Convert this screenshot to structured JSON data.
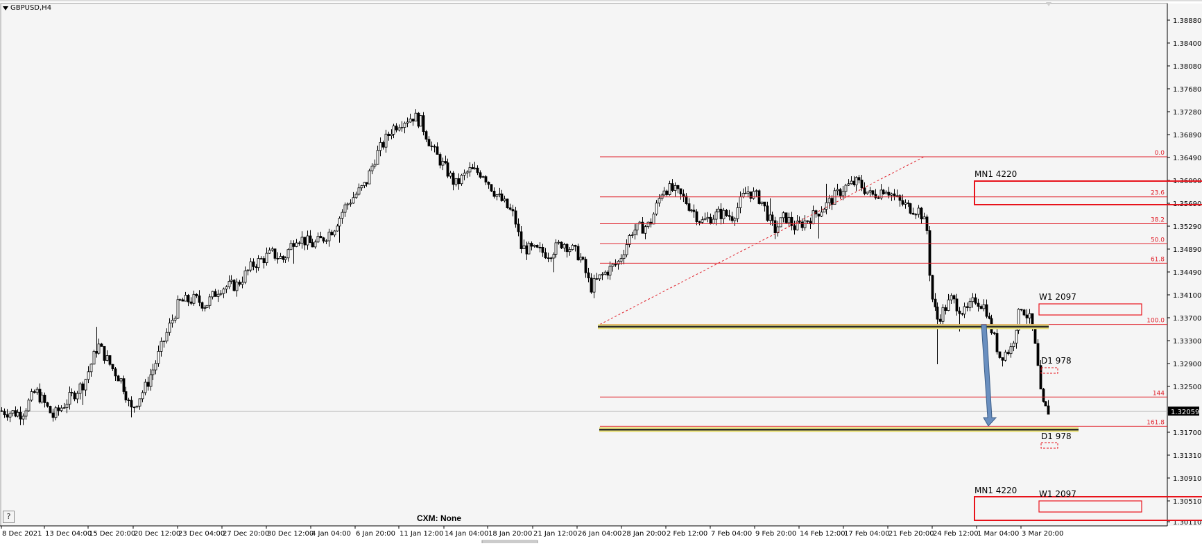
{
  "window": {
    "symbol": "GBPUSD,H4",
    "dropdown_icon": "triangle-down-icon",
    "help_label": "?"
  },
  "overlay": {
    "cxm_label": "CXM: None"
  },
  "price_axis": {
    "ticks": [
      "1.38880",
      "1.38400",
      "1.38080",
      "1.37680",
      "1.37280",
      "1.36890",
      "1.36490",
      "1.36090",
      "1.35690",
      "1.35290",
      "1.34890",
      "1.34490",
      "1.34100",
      "1.33700",
      "1.33300",
      "1.32900",
      "1.32500",
      "1.32059",
      "1.31700",
      "1.31310",
      "1.30910",
      "1.30510",
      "1.30110"
    ],
    "current_price": "1.32059"
  },
  "time_axis": {
    "labels": [
      "8 Dec 2021",
      "13 Dec 04:00",
      "15 Dec 20:00",
      "20 Dec 12:00",
      "23 Dec 04:00",
      "27 Dec 20:00",
      "30 Dec 12:00",
      "4 Jan 04:00",
      "6 Jan 20:00",
      "11 Jan 12:00",
      "14 Jan 04:00",
      "18 Jan 20:00",
      "21 Jan 12:00",
      "26 Jan 04:00",
      "28 Jan 20:00",
      "2 Feb 12:00",
      "7 Feb 04:00",
      "9 Feb 20:00",
      "14 Feb 12:00",
      "17 Feb 04:00",
      "21 Feb 20:00",
      "24 Feb 12:00",
      "1 Mar 04:00",
      "3 Mar 20:00"
    ]
  },
  "fibonacci": {
    "levels": [
      {
        "label": "0.0",
        "price": 1.3649
      },
      {
        "label": "23.6",
        "price": 1.3579
      },
      {
        "label": "38.2",
        "price": 1.3532
      },
      {
        "label": "50.0",
        "price": 1.3497
      },
      {
        "label": "61.8",
        "price": 1.3463
      },
      {
        "label": "100.0",
        "price": 1.3356
      },
      {
        "label": "144",
        "price": 1.3229
      },
      {
        "label": "161.8",
        "price": 1.3178
      }
    ]
  },
  "zones": [
    {
      "label": "MN1 4220",
      "style": "solid"
    },
    {
      "label": "W1 2097",
      "style": "solid"
    },
    {
      "label": "D1 978",
      "style": "dashed"
    },
    {
      "label": "D1 978",
      "style": "dashed"
    },
    {
      "label": "MN1 4220",
      "style": "solid"
    },
    {
      "label": "W1 2097",
      "style": "solid"
    }
  ],
  "support_lines": [
    {
      "name": "upper-support",
      "price": 1.3352
    },
    {
      "name": "lower-support",
      "price": 1.3172
    }
  ],
  "colors": {
    "background": "#f5f5f5",
    "fib": "#e0202a",
    "candle": "#000000",
    "support": "#2a2a2a",
    "support_glow": "#e8e07a",
    "arrow": "#6a8fbf"
  },
  "chart_data": {
    "type": "candlestick",
    "title": "GBPUSD,H4",
    "ylim": [
      1.2995,
      1.3905
    ],
    "x": [
      "8 Dec 2021",
      "13 Dec 04:00",
      "15 Dec 20:00",
      "20 Dec 12:00",
      "23 Dec 04:00",
      "27 Dec 20:00",
      "30 Dec 12:00",
      "4 Jan 04:00",
      "6 Jan 20:00",
      "11 Jan 12:00",
      "14 Jan 04:00",
      "18 Jan 20:00",
      "21 Jan 12:00",
      "26 Jan 04:00",
      "28 Jan 20:00",
      "2 Feb 12:00",
      "7 Feb 04:00",
      "9 Feb 20:00",
      "14 Feb 12:00",
      "17 Feb 04:00",
      "21 Feb 20:00",
      "24 Feb 12:00",
      "1 Mar 04:00",
      "3 Mar 20:00"
    ],
    "series": [
      {
        "name": "close",
        "values": [
          1.3205,
          1.322,
          1.333,
          1.32,
          1.326,
          1.339,
          1.343,
          1.348,
          1.358,
          1.372,
          1.366,
          1.358,
          1.347,
          1.34,
          1.352,
          1.355,
          1.354,
          1.356,
          1.353,
          1.362,
          1.358,
          1.336,
          1.34,
          1.3205
        ]
      }
    ]
  }
}
